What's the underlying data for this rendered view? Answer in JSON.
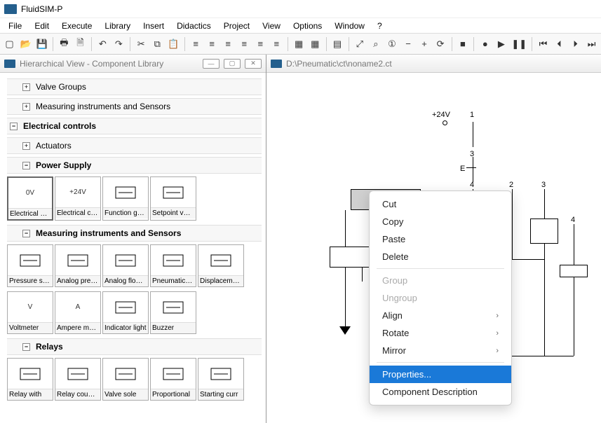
{
  "app": {
    "title": "FluidSIM-P"
  },
  "menu": [
    "File",
    "Edit",
    "Execute",
    "Library",
    "Insert",
    "Didactics",
    "Project",
    "View",
    "Options",
    "Window",
    "?"
  ],
  "toolbar_icons": [
    "new-icon",
    "open-icon",
    "save-icon",
    "sep",
    "print-icon",
    "print-preview-icon",
    "sep",
    "undo-icon",
    "redo-icon",
    "sep",
    "cut-icon",
    "copy-icon",
    "paste-icon",
    "sep",
    "align-left-icon",
    "align-center-icon",
    "align-right-icon",
    "align-top-icon",
    "align-middle-icon",
    "align-bottom-icon",
    "sep",
    "grid-icon",
    "snap-icon",
    "sep",
    "table-icon",
    "sep",
    "zoom-fit-icon",
    "zoom-sel-icon",
    "zoom-1-icon",
    "zoom-out-icon",
    "zoom-in-icon",
    "zoom-reset-icon",
    "sep",
    "stop-icon",
    "sep",
    "rec-icon",
    "play-icon",
    "pause-icon",
    "sep",
    "skip-back-icon",
    "step-back-icon",
    "step-fwd-icon",
    "skip-fwd-icon"
  ],
  "toolbar_glyphs": {
    "new-icon": "▢",
    "open-icon": "📂",
    "save-icon": "💾",
    "print-icon": "🖶",
    "print-preview-icon": "🗎",
    "undo-icon": "↶",
    "redo-icon": "↷",
    "cut-icon": "✂",
    "copy-icon": "⧉",
    "paste-icon": "📋",
    "align-left-icon": "≡",
    "align-center-icon": "≡",
    "align-right-icon": "≡",
    "align-top-icon": "≡",
    "align-middle-icon": "≡",
    "align-bottom-icon": "≡",
    "grid-icon": "▦",
    "snap-icon": "▦",
    "table-icon": "▤",
    "zoom-fit-icon": "⤢",
    "zoom-sel-icon": "⌕",
    "zoom-1-icon": "①",
    "zoom-out-icon": "−",
    "zoom-in-icon": "+",
    "zoom-reset-icon": "⟳",
    "stop-icon": "■",
    "rec-icon": "●",
    "play-icon": "▶",
    "pause-icon": "❚❚",
    "skip-back-icon": "⏮",
    "step-back-icon": "⏴",
    "step-fwd-icon": "⏵",
    "skip-fwd-icon": "⏭"
  },
  "left": {
    "title": "Hierarchical View - Component Library",
    "sections": [
      {
        "label": "Valve Groups",
        "indent": 1,
        "sym": "+"
      },
      {
        "label": "Measuring instruments and Sensors",
        "indent": 1,
        "sym": "+"
      },
      {
        "label": "Electrical controls",
        "indent": 0,
        "bold": true,
        "sym": "−"
      },
      {
        "label": "Actuators",
        "indent": 1,
        "sym": "+"
      },
      {
        "label": "Power Supply",
        "indent": 1,
        "bold": true,
        "sym": "−"
      }
    ],
    "power_supply": [
      {
        "label": "Electrical co...",
        "top": "0V",
        "selected": true
      },
      {
        "label": "Electrical co...",
        "top": "+24V"
      },
      {
        "label": "Function ge...",
        "top": ""
      },
      {
        "label": "Setpoint val...",
        "top": ""
      }
    ],
    "measuring_header": "Measuring instruments and Sensors",
    "measuring_row1": [
      {
        "label": "Pressure se..."
      },
      {
        "label": "Analog pres..."
      },
      {
        "label": "Analog flow ..."
      },
      {
        "label": "Pneumatic t..."
      },
      {
        "label": "Displaceme..."
      }
    ],
    "measuring_row2": [
      {
        "label": "Voltmeter",
        "top": "V"
      },
      {
        "label": "Ampere meter",
        "top": "A"
      },
      {
        "label": "Indicator light"
      },
      {
        "label": "Buzzer"
      }
    ],
    "relays_header": "Relays",
    "relays_row": [
      {
        "label": "Relay with"
      },
      {
        "label": "Relay counter"
      },
      {
        "label": "Valve sole"
      },
      {
        "label": "Proportional"
      },
      {
        "label": "Starting curr"
      }
    ]
  },
  "right": {
    "title": "D:\\Pneumatic\\ct\\noname2.ct",
    "labels": {
      "v24": "+24V",
      "n1": "1",
      "n2": "2",
      "n3": "3",
      "n3b": "3",
      "n4": "4",
      "n4b": "4",
      "E": "E"
    }
  },
  "ctx": {
    "cut": "Cut",
    "copy": "Copy",
    "paste": "Paste",
    "delete": "Delete",
    "group": "Group",
    "ungroup": "Ungroup",
    "align": "Align",
    "rotate": "Rotate",
    "mirror": "Mirror",
    "properties": "Properties...",
    "desc": "Component Description"
  }
}
